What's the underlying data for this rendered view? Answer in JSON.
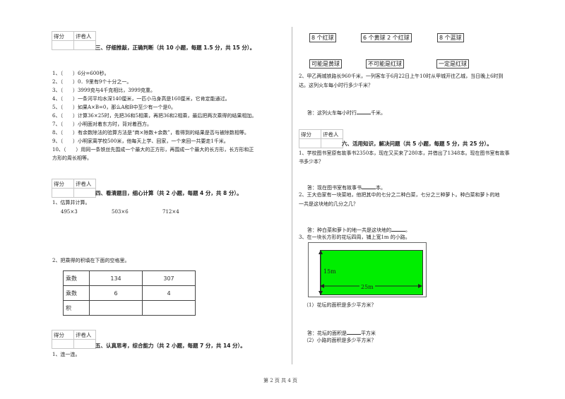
{
  "score_table": {
    "col1": "得分",
    "col2": "评卷人"
  },
  "section3": {
    "title": "三、仔细推敲，正确判断（共 10 小题，每题 1.5 分，共 15 分）。",
    "items": [
      "1、（　　）6分=600秒。",
      "2、（　　）0．9里有9个十分之一。",
      "3、（　　）3999克与4千克相比，3999克重。",
      "4、（　　）一条河平均水深140厘米，一匹小马身高是160厘米，它肯定能通过。",
      "5、（　　）如果A×B=0，那么A和B中至少有一个是0。",
      "6、（　　）计算36×25时，先把36和5相乘，再把36和2相乘，最后把两次乘得的结果相加。",
      "7、（　　）小明面对着东方时，背对着西方。",
      "8、（　　）有余数除法的验算方法是“商×除数+余数”，看得到的结果是否与被除数相等。",
      "9、（　　）小明家离学校500米，他每天上学、回家，一个来回一共要走1千米。",
      "10、（　　）用同一条铁丝先围成一个最大的正方形，再围成一个最大的长方形，长方形和正",
      "方形的周长相等。"
    ]
  },
  "section4": {
    "title": "四、看清题目，细心计算（共 2 小题，每题 4 分，共 8 分）。",
    "q1": "1、估算并计算。",
    "calcs": [
      "495×3",
      "503×6",
      "712×4"
    ],
    "q2": "2、把乘得的积填在下面的空格里。",
    "table": {
      "rows": [
        {
          "label": "乘数",
          "values": [
            "134",
            "307"
          ]
        },
        {
          "label": "乘数",
          "values": [
            "6",
            "4"
          ]
        },
        {
          "label": "积",
          "values": [
            "",
            ""
          ]
        }
      ]
    }
  },
  "section5": {
    "title": "五、认真思考，综合能力（共 2 小题，每题 7 分，共 14 分）。",
    "q1": "1、连一连。"
  },
  "match": {
    "top": [
      "8 个红球",
      "6 个黄球 2 个红球",
      "8 个蓝球"
    ],
    "bottom": [
      "可能是黄球",
      "不可能是红球",
      "一定是红球"
    ]
  },
  "right_q2": {
    "text1": "2、甲乙两城铁路长960千米，一列客车于6月22日上午10时从甲城开往乙城，当日晚上6时到",
    "text2": "达。这列火车每小时行多少千米？",
    "answer_pre": "答：这列火车每小时行",
    "answer_post": "千米。"
  },
  "section6": {
    "title": "六、活用知识，解决问题（共 5 小题，每题 5 分，共 25 分）。",
    "q1_line1": "1、学校图书室原有故事书2350本，现在又买来了280本，并借出了1348本。现在图书室有故事",
    "q1_line2": "书多少本？",
    "q1_ans_pre": "答：现在图书室有故事书",
    "q1_ans_post": "本。",
    "q2_line1": "2、王大伯家有一块菜地，他把其中的七分之二种白菜，七分之三种萝卜。种白菜和萝卜的地",
    "q2_line2": "一共是这块地的几分之几？",
    "q2_ans_pre": "答：种白菜和萝卜的地一共是这块地的",
    "q2_ans_post": "。",
    "q3": "3、在一块长方形的花坛四周，铺上宽1m 的小路。",
    "figure": {
      "height_label": "15m",
      "width_label": "25m",
      "fill_color": "#00ee00"
    },
    "q3_sub1": "（1）花坛的面积是多少平方米？",
    "q3_ans1_pre": "答：花坛的面积是",
    "q3_ans1_post": "平方米",
    "q3_sub2": "（2）小路的面积是多少平方米？"
  },
  "footer": {
    "page": "第 2 页 共 4 页"
  }
}
